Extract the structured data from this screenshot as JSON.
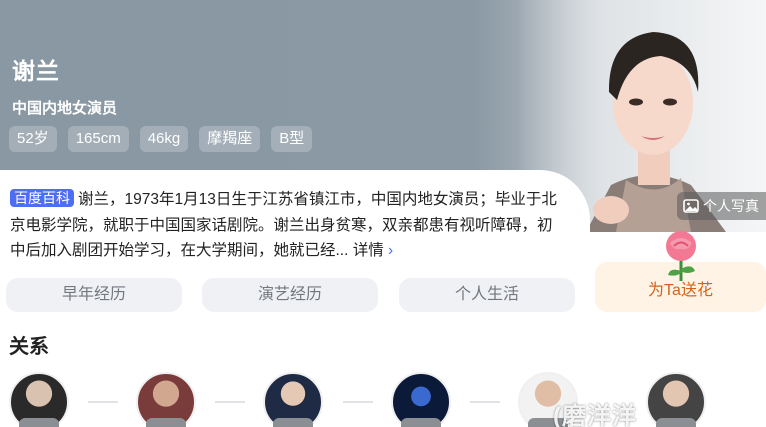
{
  "header": {
    "name": "谢兰",
    "subtitle": "中国内地女演员",
    "tags": [
      "52岁",
      "165cm",
      "46kg",
      "摩羯座",
      "B型"
    ],
    "photo_button_label": "个人写真"
  },
  "intro": {
    "badge": "百度百科",
    "text": "谢兰，1973年1月13日生于江苏省镇江市，中国内地女演员；毕业于北京电影学院，就职于中国国家话剧院。谢兰出身贫寒，双亲都患有视听障碍，初中后加入剧团开始学习，在大学期间，她就已经...",
    "more_label": "详情",
    "more_icon": "chevron-right-icon"
  },
  "tabs": [
    {
      "label": "早年经历"
    },
    {
      "label": "演艺经历"
    },
    {
      "label": "个人生活"
    }
  ],
  "flower_button": {
    "label": "为Ta送花",
    "icon": "rose-icon"
  },
  "relations": {
    "title": "关系",
    "count_visible": 6
  },
  "watermark": "磨洋洋",
  "colors": {
    "accent": "#4e6ef2",
    "flower_text": "#d4631a",
    "flower_bg": "#fff3e6",
    "pill_bg": "#eff1f4",
    "hero_bg": "#8a98a3"
  }
}
